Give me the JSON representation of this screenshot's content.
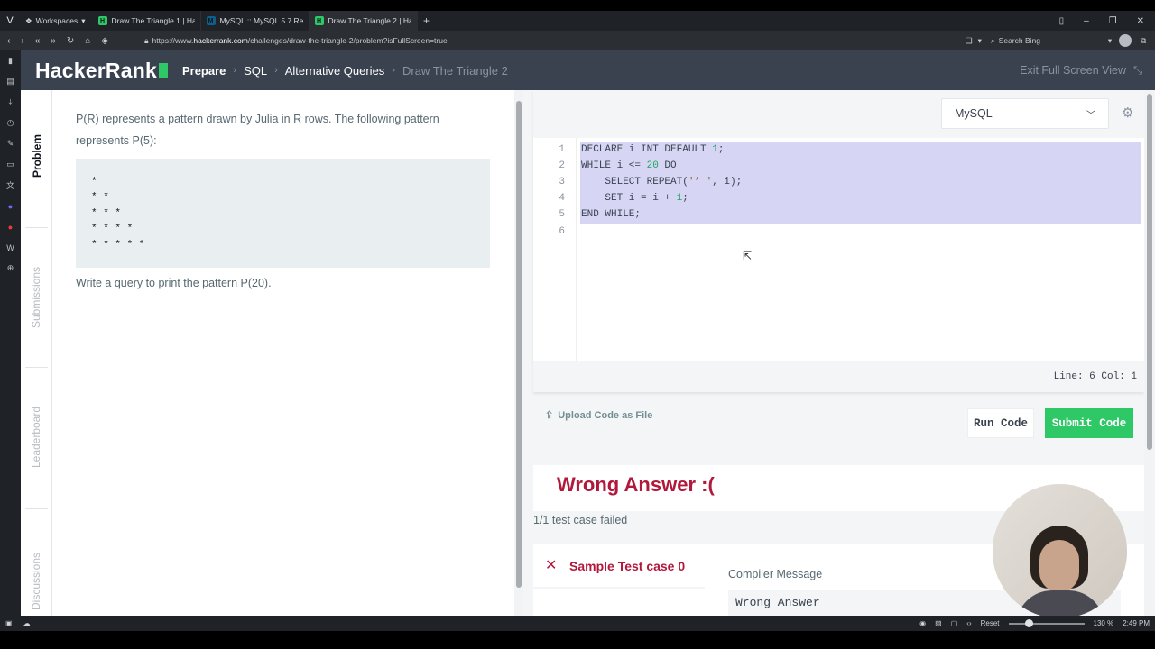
{
  "browser": {
    "workspaces_label": "Workspaces",
    "tabs": [
      {
        "title": "Draw The Triangle 1 | Hacke",
        "fav": "H"
      },
      {
        "title": "MySQL :: MySQL 5.7 Refere",
        "fav": "M"
      },
      {
        "title": "Draw The Triangle 2 | Hacke",
        "fav": "H"
      }
    ],
    "url_prefix": "https://www.",
    "url_domain": "hackerrank.com",
    "url_path": "/challenges/draw-the-triangle-2/problem?isFullScreen=true",
    "search_placeholder": "Search Bing"
  },
  "header": {
    "logo": "HackerRank",
    "breadcrumbs": [
      "Prepare",
      "SQL",
      "Alternative Queries",
      "Draw The Triangle 2"
    ],
    "exit_fullscreen": "Exit Full Screen View"
  },
  "left_tabs": [
    "Problem",
    "Submissions",
    "Leaderboard",
    "Discussions"
  ],
  "problem": {
    "description": "P(R) represents a pattern drawn by Julia in R rows. The following pattern represents P(5):",
    "pattern": [
      "*",
      "* *",
      "* * *",
      "* * * *",
      "* * * * *"
    ],
    "query_prompt": "Write a query to print the pattern P(20)."
  },
  "editor": {
    "language": "MySQL",
    "line_numbers": [
      "1",
      "2",
      "3",
      "4",
      "5",
      "6"
    ],
    "status": "Line: 6 Col: 1"
  },
  "actions": {
    "upload": "Upload Code as File",
    "run": "Run Code",
    "submit": "Submit Code"
  },
  "result": {
    "heading": "Wrong Answer :(",
    "summary": "1/1 test case failed",
    "test_case": "Sample Test case 0",
    "compiler_label": "Compiler Message",
    "compiler_message": "Wrong Answer"
  },
  "statusbar": {
    "reset": "Reset",
    "zoom": "130 %",
    "time": "2:49 PM"
  },
  "colors": {
    "brand_green": "#2ec866",
    "header_bg": "#39424e",
    "error_red": "#b2183b",
    "selection": "#d6d6f4"
  }
}
